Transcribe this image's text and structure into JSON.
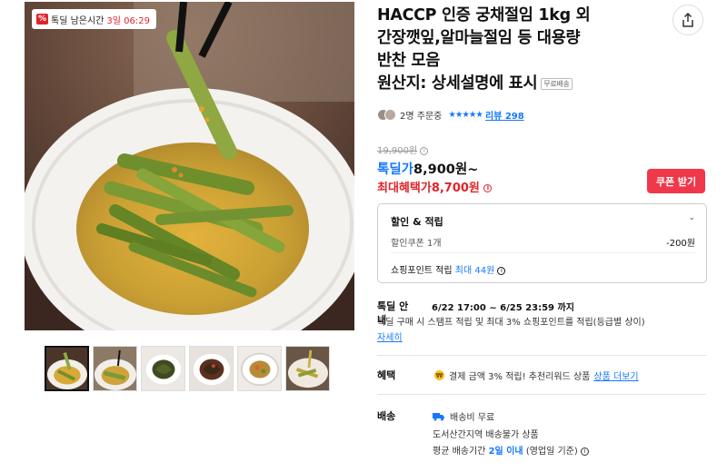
{
  "timer": {
    "label": "톡딜 남은시간",
    "time": "3일 06:29"
  },
  "product": {
    "title_lines": [
      "HACCP 인증 궁채절임 1kg 외",
      "간장깻잎,알마늘절임 등 대용량",
      "반찬 모음"
    ],
    "origin": "원산지: 상세설명에 표시",
    "free_shipping_chip": "무료배송"
  },
  "buyers": {
    "text": "2명 주문중",
    "stars": "★★★★★",
    "review_link": "리뷰 298"
  },
  "price": {
    "original": "19,900원",
    "deal_label": "톡딜가",
    "deal_price": "8,900원~",
    "max_label": "최대혜택가",
    "max_price": "8,700원"
  },
  "coupon_button": "쿠폰 받기",
  "discount_box": {
    "title": "할인 & 적립",
    "coupon_label": "할인쿠폰 1개",
    "coupon_value": "-200원",
    "points_label": "쇼핑포인트 적립",
    "points_value": "최대 44원"
  },
  "deal_info": {
    "label": "톡딜 안내",
    "period": "6/22 17:00 ~ 6/25 23:59 까지",
    "desc": "톡딜 구매 시 스탬프 적립 및 최대 3% 쇼핑포인트를 적립(등급별 상이)",
    "more": "자세히"
  },
  "benefit": {
    "label": "혜택",
    "coin": "₩",
    "text": "결제 금액 3% 적립! 추천리워드 상품",
    "link": "상품 더보기"
  },
  "shipping": {
    "label": "배송",
    "fee": "배송비 무료",
    "restriction": "도서산간지역 배송불가 상품",
    "avg_prefix": "평균 배송기간",
    "avg_days": "2일 이내",
    "avg_suffix": "(영업일 기준)"
  },
  "colors": {
    "accent_blue": "#1677ff",
    "accent_red": "#e0242a",
    "coupon_bg": "#f0384b"
  },
  "icons": [
    "share-icon",
    "info-icon",
    "chevron-down-icon",
    "coin-icon",
    "truck-icon",
    "percent-icon"
  ]
}
